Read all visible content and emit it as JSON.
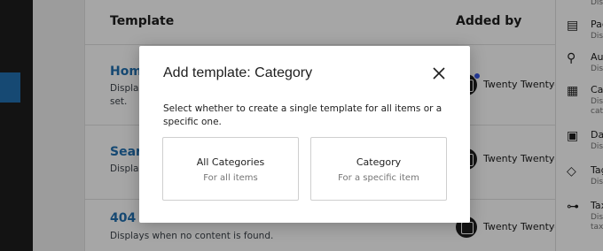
{
  "table": {
    "headers": {
      "template": "Template",
      "added_by": "Added by"
    },
    "rows": [
      {
        "title": "Home",
        "desc_lines": [
          "Display",
          "set."
        ],
        "theme": "Twenty Twenty-T"
      },
      {
        "title": "Search",
        "desc_lines": [
          "Display"
        ],
        "theme": "Twenty Twenty-T"
      },
      {
        "title": "404",
        "desc_lines": [
          "Displays when no content is found."
        ],
        "theme": "Twenty Twenty-T"
      }
    ]
  },
  "right_panel": {
    "items": [
      {
        "icon": "page-icon",
        "glyph": "▤",
        "name": "Pag",
        "sub_lines": [
          "Displ"
        ]
      },
      {
        "icon": "author-icon",
        "glyph": "⚲",
        "name": "Aut",
        "sub_lines": [
          "Displ"
        ]
      },
      {
        "icon": "category-icon",
        "glyph": "▦",
        "name": "Cat",
        "sub_lines": [
          "Displ",
          "cate"
        ]
      },
      {
        "icon": "date-icon",
        "glyph": "▣",
        "name": "Dat",
        "sub_lines": [
          "Displ"
        ]
      },
      {
        "icon": "tag-icon",
        "glyph": "◇",
        "name": "Tag",
        "sub_lines": [
          "Displ"
        ]
      },
      {
        "icon": "taxonomy-icon",
        "glyph": "⊶",
        "name": "Taxo",
        "sub_lines": [
          "Displ",
          "taxo"
        ]
      }
    ],
    "top_sub": "Displ"
  },
  "modal": {
    "title": "Add template: Category",
    "description": "Select whether to create a single template for all items or a specific one.",
    "close_icon": "close-icon",
    "options": [
      {
        "title": "All Categories",
        "subtitle": "For all items"
      },
      {
        "title": "Category",
        "subtitle": "For a specific item"
      }
    ]
  },
  "colors": {
    "link": "#2271b1",
    "admin_sidebar": "#1e1e1e",
    "accent_dot": "#3858e9"
  }
}
